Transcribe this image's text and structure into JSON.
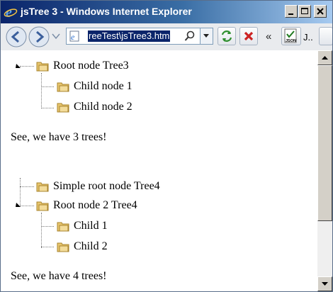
{
  "window": {
    "title": "jsTree 3 - Windows Internet Explorer"
  },
  "address": {
    "url": "reeTest\\jsTree3.htm"
  },
  "toolbar": {
    "chevron": "«",
    "json_tab": "J.."
  },
  "tree3": {
    "root": "Root node Tree3",
    "children": [
      "Child node 1",
      "Child node 2"
    ]
  },
  "text1": "See, we have 3 trees!",
  "tree4": {
    "simple_root": "Simple root node Tree4",
    "root2": "Root node 2 Tree4",
    "children": [
      "Child 1",
      "Child 2"
    ]
  },
  "text2": "See, we have 4 trees!",
  "colors": {
    "titlebar": "#0a246a",
    "selection": "#0a246a",
    "folder": "#e8c66e"
  },
  "icons": [
    "ie-logo-icon",
    "minimize-icon",
    "maximize-icon",
    "close-icon",
    "back-icon",
    "forward-icon",
    "page-icon",
    "search-icon",
    "dropdown-icon",
    "refresh-icon",
    "stop-icon",
    "json-icon",
    "folder-icon"
  ]
}
